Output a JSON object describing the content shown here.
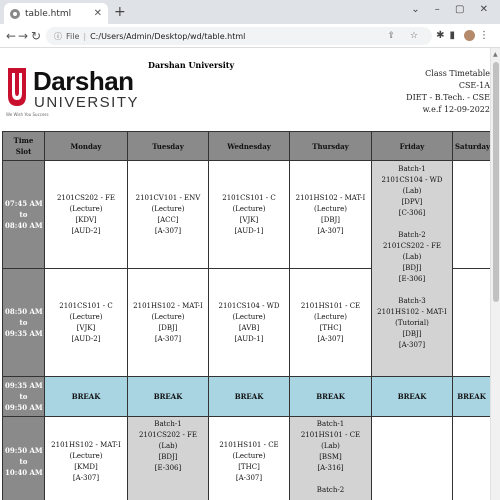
{
  "browser": {
    "tab_title": "table.html",
    "tab_close": "✕",
    "new_tab": "+",
    "url_scheme": "File",
    "url": "C:/Users/Admin/Desktop/wd/table.html"
  },
  "header": {
    "logo_name": "Darshan",
    "logo_sub": "UNIVERSITY",
    "logo_tag": "We Wish You Success",
    "university": "Darshan University",
    "info": [
      "Class Timetable",
      "CSE-1A",
      "DIET - B.Tech. - CSE",
      "w.e.f 12-09-2022"
    ]
  },
  "table": {
    "headers": [
      "Time Slot",
      "Monday",
      "Tuesday",
      "Wednesday",
      "Thursday",
      "Friday",
      "Saturday"
    ],
    "time_slots": [
      [
        "07:45 AM",
        "to",
        "08:40 AM"
      ],
      [
        "08:50 AM",
        "to",
        "09:35 AM"
      ],
      [
        "09:35 AM",
        "to",
        "09:50 AM"
      ],
      [
        "09:50 AM",
        "to",
        "10:40 AM"
      ]
    ],
    "row1": {
      "monday": [
        "2101CS202 - FE",
        "(Lecture)",
        "[KDV]",
        "[AUD-2]"
      ],
      "tuesday": [
        "2101CV101 - ENV",
        "(Lecture)",
        "[ACC]",
        "[A-307]"
      ],
      "wednesday": [
        "2101CS101 - C",
        "(Lecture)",
        "[VJK]",
        "[AUD-1]"
      ],
      "thursday": [
        "2101HS102 - MAT-I",
        "(Lecture)",
        "[DBJ]",
        "[A-307]"
      ]
    },
    "friday_lab": {
      "b1": [
        "Batch-1",
        "2101CS104 - WD",
        "(Lab)",
        "[DPV]",
        "[C-306]"
      ],
      "b2": [
        "Batch-2",
        "2101CS202 - FE",
        "(Lab)",
        "[BDJ]",
        "[E-306]"
      ],
      "b3": [
        "Batch-3",
        "2101HS102 - MAT-I",
        "(Tutorial)",
        "[DBJ]",
        "[A-307]"
      ]
    },
    "row2": {
      "monday": [
        "2101CS101 - C",
        "(Lecture)",
        "[VJK]",
        "[AUD-2]"
      ],
      "tuesday": [
        "2101HS102 - MAT-I",
        "(Lecture)",
        "[DBJ]",
        "[A-307]"
      ],
      "wednesday": [
        "2101CS104 - WD",
        "(Lecture)",
        "[AVB]",
        "[AUD-1]"
      ],
      "thursday": [
        "2101HS101 - CE",
        "(Lecture)",
        "[THC]",
        "[A-307]"
      ]
    },
    "break_label": "BREAK",
    "row4": {
      "monday": [
        "2101HS102 - MAT-I",
        "(Lecture)",
        "[KMD]",
        "[A-307]"
      ],
      "tuesday": [
        "Batch-1",
        "2101CS202 - FE",
        "(Lab)",
        "[BDJ]",
        "[E-306]"
      ],
      "wednesday": [
        "2101HS101 - CE",
        "(Lecture)",
        "[THC]",
        "[A-307]"
      ],
      "thursday": [
        "Batch-1",
        "2101HS101 - CE",
        "(Lab)",
        "[BSM]",
        "[A-316]",
        "Batch-2"
      ]
    }
  }
}
